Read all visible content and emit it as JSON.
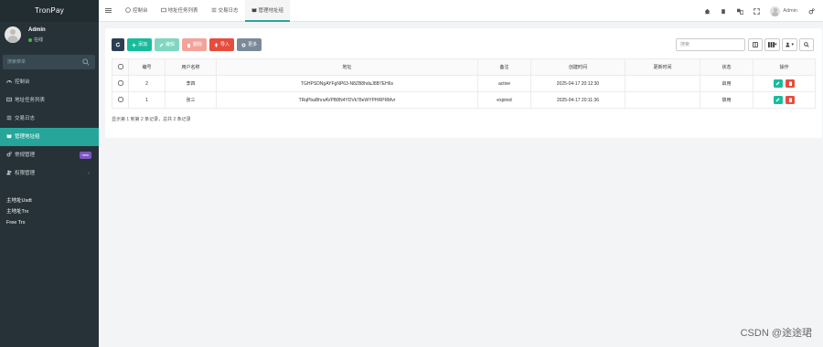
{
  "app": {
    "brand": "TronPay"
  },
  "user": {
    "name": "Admin",
    "status": "在线"
  },
  "sidebar": {
    "search_placeholder": "搜索菜单",
    "items": [
      {
        "label": "控制台",
        "icon": "dashboard-icon"
      },
      {
        "label": "地址任务列表",
        "icon": "list-icon"
      },
      {
        "label": "交易日志",
        "icon": "log-icon"
      },
      {
        "label": "管理地址组",
        "icon": "book-icon",
        "active": true
      },
      {
        "label": "常规管理",
        "icon": "cogs-icon",
        "badge": "new"
      },
      {
        "label": "权限管理",
        "icon": "users-icon"
      }
    ],
    "links": [
      "主地址Usdt",
      "主地址Trx",
      "Free Trx"
    ]
  },
  "topbar": {
    "tabs": [
      {
        "label": "控制台",
        "icon": "dashboard-icon"
      },
      {
        "label": "地址任务列表",
        "icon": "list-icon"
      },
      {
        "label": "交易日志",
        "icon": "log-icon"
      },
      {
        "label": "管理地址组",
        "icon": "book-icon",
        "active": true
      }
    ],
    "user_name": "Admin"
  },
  "toolbar": {
    "add": "添加",
    "edit": "编辑",
    "delete": "删除",
    "import": "导入",
    "more": "更多",
    "search_placeholder": "搜索"
  },
  "table": {
    "headers": [
      "",
      "编号",
      "用户名称",
      "地址",
      "备注",
      "创建时间",
      "更新时间",
      "状态",
      "操作"
    ],
    "rows": [
      {
        "id": "2",
        "name": "李四",
        "address": "TGHPSDNgAYFgNP63-N8ZB8hduJ8B7EH6s",
        "remark": "active",
        "created": "2025-04-17 20:12:30",
        "updated": "",
        "status": "启用"
      },
      {
        "id": "1",
        "name": "张三",
        "address": "TRqPbaBhrsAVPB8N4YDVk78eWYPHRPRMvr",
        "remark": "expired",
        "created": "2025-04-17 20:11:36",
        "updated": "",
        "status": "禁用"
      }
    ],
    "summary": "显示第 1 到第 2 条记录，总共 2 条记录"
  },
  "watermark": "CSDN @途途珺",
  "colors": {
    "sidebar": "#263238",
    "accent": "#26a69a",
    "danger": "#e74c3c",
    "success": "#18bc9c"
  }
}
